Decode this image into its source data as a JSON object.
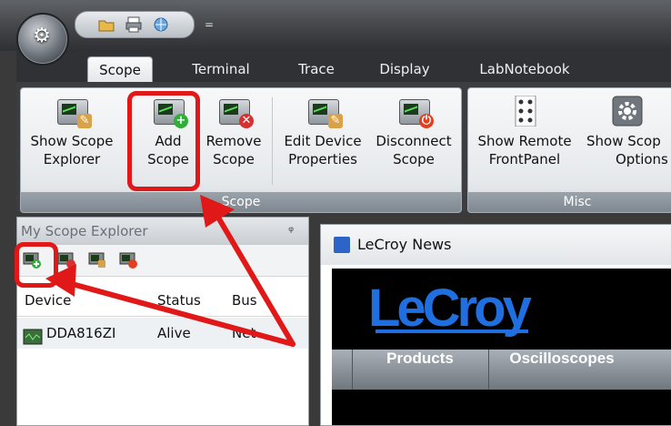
{
  "qat": {
    "dropdown": "="
  },
  "tabs": [
    {
      "label": "Scope"
    },
    {
      "label": "Terminal"
    },
    {
      "label": "Trace"
    },
    {
      "label": "Display"
    },
    {
      "label": "LabNotebook"
    }
  ],
  "ribbon": {
    "scope_group": {
      "label": "Scope",
      "buttons": [
        {
          "line1": "Show Scope",
          "line2": "Explorer"
        },
        {
          "line1": "Add",
          "line2": "Scope"
        },
        {
          "line1": "Remove",
          "line2": "Scope"
        },
        {
          "line1": "Edit Device",
          "line2": "Properties"
        },
        {
          "line1": "Disconnect",
          "line2": "Scope"
        }
      ]
    },
    "misc_group": {
      "label": "Misc",
      "buttons": [
        {
          "line1": "Show Remote",
          "line2": "FrontPanel"
        },
        {
          "line1": "Show Scop",
          "line2": "Options"
        }
      ]
    }
  },
  "explorer": {
    "title": "My Scope Explorer",
    "pin": "ᵠ",
    "columns": [
      "Device",
      "Status",
      "Bus"
    ],
    "rows": [
      {
        "device": "DDA816ZI",
        "status": "Alive",
        "bus": "Net"
      }
    ]
  },
  "news": {
    "title": "LeCroy News",
    "logo": "LeCroy",
    "nav": [
      "Products",
      "Oscilloscopes"
    ]
  },
  "colors": {
    "highlight": "#e01818",
    "logo_blue": "#1f6fe0"
  }
}
